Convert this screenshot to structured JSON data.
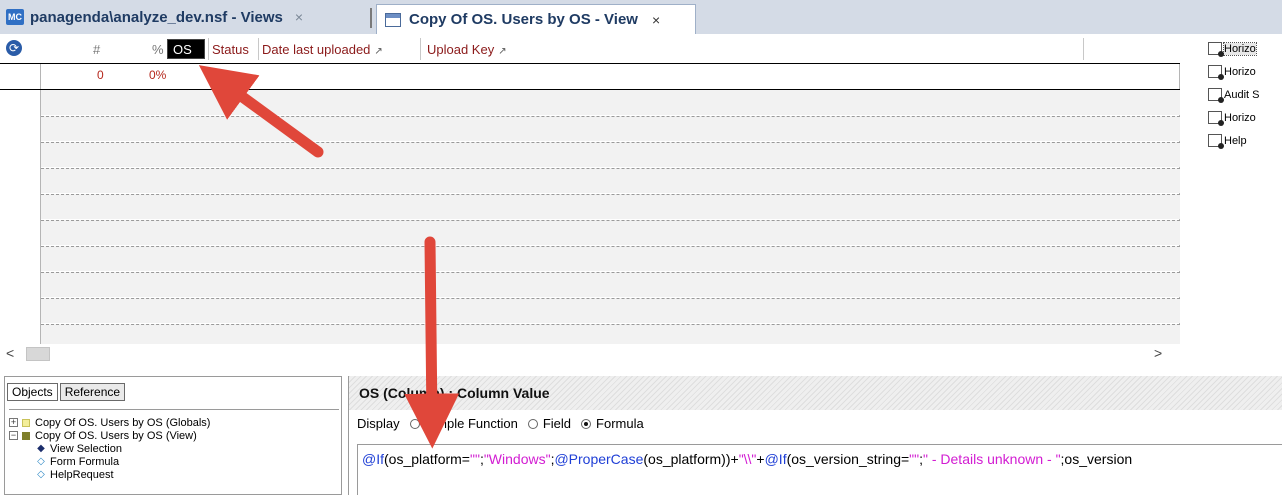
{
  "tabs": [
    {
      "logo": "MC",
      "title": "panagenda\\analyze_dev.nsf - Views",
      "close": "×"
    },
    {
      "title": "Copy Of OS. Users by OS - View",
      "close": "×"
    }
  ],
  "columns": {
    "count": "#",
    "percent": "%",
    "os": "OS",
    "status": "Status",
    "date_uploaded": "Date last uploaded",
    "upload_key": "Upload Key",
    "sort_icon": "↗"
  },
  "total_row": {
    "count": "0",
    "percent": "0%"
  },
  "scrollbar": {
    "left": "<",
    "right": ">"
  },
  "actions": [
    "Horizo",
    "Horizo",
    "Audit S",
    "Horizo",
    "Help"
  ],
  "objects_pane": {
    "tabs": [
      "Objects",
      "Reference"
    ],
    "tree": [
      {
        "expander": "+",
        "color": "#e8e27a",
        "label": "Copy Of OS. Users by OS (Globals)"
      },
      {
        "expander": "−",
        "color": "#7f7f2a",
        "label": "Copy Of OS. Users by OS (View)"
      }
    ],
    "children": [
      {
        "glyph": "◆",
        "label": "View Selection"
      },
      {
        "glyph": "◇",
        "label": "Form Formula"
      },
      {
        "glyph": "◇",
        "label": "HelpRequest"
      }
    ]
  },
  "programmer_pane": {
    "title": "OS (Column) : Column Value",
    "display_label": "Display",
    "options": [
      {
        "label": "Simple Function",
        "selected": false
      },
      {
        "label": "Field",
        "selected": false
      },
      {
        "label": "Formula",
        "selected": true
      }
    ],
    "formula_parts": [
      {
        "t": "@If",
        "c": "f-kw"
      },
      {
        "t": "(os_platform=",
        "c": "f-pl"
      },
      {
        "t": "\"\"",
        "c": "f-str"
      },
      {
        "t": ";",
        "c": "f-pl"
      },
      {
        "t": "\"Windows\"",
        "c": "f-str"
      },
      {
        "t": ";",
        "c": "f-pl"
      },
      {
        "t": "@ProperCase",
        "c": "f-kw"
      },
      {
        "t": "(os_platform))+",
        "c": "f-pl"
      },
      {
        "t": "\"\\\\\"",
        "c": "f-str"
      },
      {
        "t": "+",
        "c": "f-pl"
      },
      {
        "t": "@If",
        "c": "f-kw"
      },
      {
        "t": "(os_version_string=",
        "c": "f-pl"
      },
      {
        "t": "\"\"",
        "c": "f-str"
      },
      {
        "t": ";",
        "c": "f-pl"
      },
      {
        "t": "\" - Details unknown - \"",
        "c": "f-str"
      },
      {
        "t": ";os_version",
        "c": "f-pl"
      }
    ]
  },
  "colors": {
    "arrow": "#e0473a",
    "header_text": "#8b1a1a",
    "total_text": "#b5271c"
  }
}
